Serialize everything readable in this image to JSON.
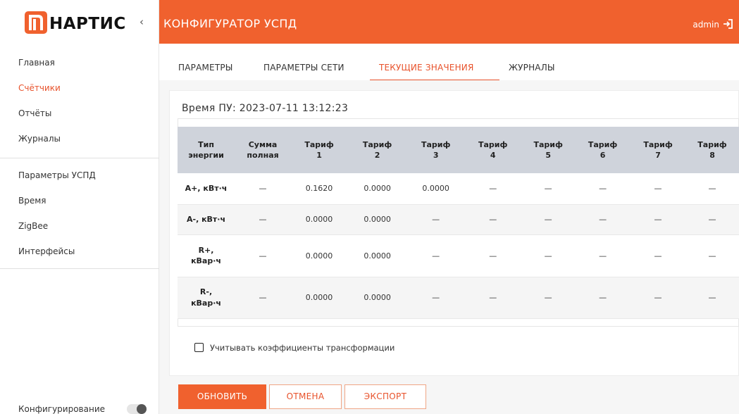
{
  "brand": {
    "logo_text": "НАРТИС",
    "accent": "#f0612e"
  },
  "sidebar": {
    "items": [
      {
        "label": "Главная"
      },
      {
        "label": "Счётчики",
        "active": true
      },
      {
        "label": "Отчёты"
      },
      {
        "label": "Журналы"
      },
      {
        "label": "Параметры УСПД"
      },
      {
        "label": "Время"
      },
      {
        "label": "ZigBee"
      },
      {
        "label": "Интерфейсы"
      }
    ],
    "config_label": "Конфигурирование",
    "config_toggle": false
  },
  "header": {
    "title": "КОНФИГУРАТОР УСПД",
    "user": "admin"
  },
  "tabs": [
    {
      "label": "ПАРАМЕТРЫ"
    },
    {
      "label": "ПАРАМЕТРЫ СЕТИ"
    },
    {
      "label": "ТЕКУЩИЕ ЗНАЧЕНИЯ",
      "active": true
    },
    {
      "label": "ЖУРНАЛЫ"
    }
  ],
  "main": {
    "device_time": "Время ПУ: 2023-07-11 13:12:23",
    "table": {
      "headers": [
        [
          "Тип",
          "энергии"
        ],
        [
          "Сумма",
          "полная"
        ],
        [
          "Тариф",
          "1"
        ],
        [
          "Тариф",
          "2"
        ],
        [
          "Тариф",
          "3"
        ],
        [
          "Тариф",
          "4"
        ],
        [
          "Тариф",
          "5"
        ],
        [
          "Тариф",
          "6"
        ],
        [
          "Тариф",
          "7"
        ],
        [
          "Тариф",
          "8"
        ]
      ],
      "rows": [
        {
          "label": [
            "А+, кВт·ч"
          ],
          "cells": [
            "—",
            "0.1620",
            "0.0000",
            "0.0000",
            "—",
            "—",
            "—",
            "—",
            "—"
          ]
        },
        {
          "label": [
            "А-, кВт·ч"
          ],
          "cells": [
            "—",
            "0.0000",
            "0.0000",
            "—",
            "—",
            "—",
            "—",
            "—",
            "—"
          ]
        },
        {
          "label": [
            "R+,",
            "кВар·ч"
          ],
          "cells": [
            "—",
            "0.0000",
            "0.0000",
            "—",
            "—",
            "—",
            "—",
            "—",
            "—"
          ]
        },
        {
          "label": [
            "R-,",
            "кВар·ч"
          ],
          "cells": [
            "—",
            "0.0000",
            "0.0000",
            "—",
            "—",
            "—",
            "—",
            "—",
            "—"
          ]
        }
      ]
    },
    "transform_checkbox": {
      "label": "Учитывать коэффициенты трансформации",
      "checked": false
    }
  },
  "actions": {
    "refresh": "ОБНОВИТЬ",
    "cancel": "ОТМЕНА",
    "export": "ЭКСПОРТ"
  }
}
